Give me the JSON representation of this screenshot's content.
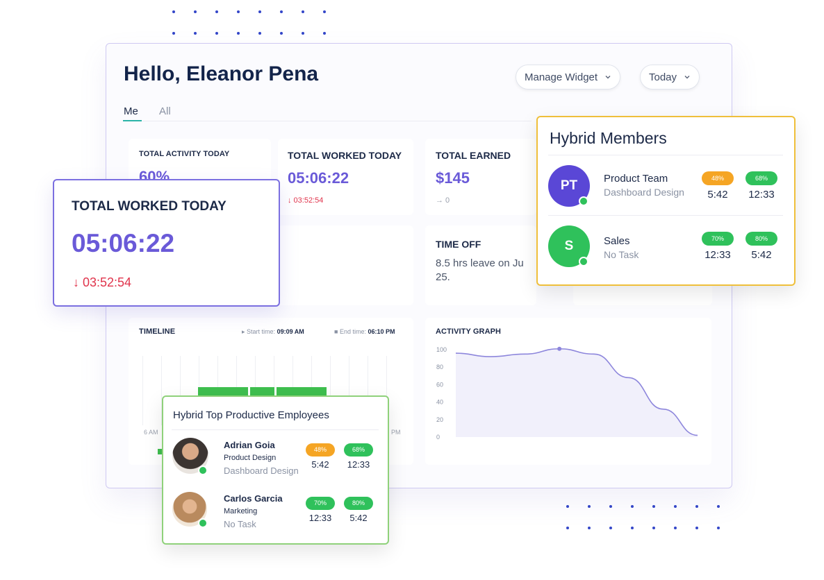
{
  "greeting": "Hello, Eleanor Pena",
  "header": {
    "manage_widget": "Manage Widget",
    "date_filter": "Today"
  },
  "tabs": [
    {
      "label": "Me",
      "active": true
    },
    {
      "label": "All",
      "active": false
    }
  ],
  "stats": {
    "activity": {
      "label": "TOTAL ACTIVITY TODAY",
      "value": "60%"
    },
    "worked": {
      "label": "TOTAL WORKED TODAY",
      "value": "05:06:22",
      "delta": "↓ 03:52:54"
    },
    "earned": {
      "label": "TOTAL EARNED",
      "value": "$145",
      "delta": "→ 0"
    },
    "time_off": {
      "label": "TIME OFF",
      "text": "8.5 hrs leave on Ju 25."
    }
  },
  "worked_popup": {
    "label": "TOTAL WORKED TODAY",
    "value": "05:06:22",
    "delta": "↓ 03:52:54"
  },
  "timeline": {
    "label": "TIMELINE",
    "start_label": "Start time:",
    "start_value": "09:09 AM",
    "end_label": "End time:",
    "end_value": "06:10 PM",
    "left_tick": "6 AM",
    "right_tick": "PM"
  },
  "chart_data": {
    "type": "line",
    "title": "ACTIVITY GRAPH",
    "xlabel": "",
    "ylabel": "",
    "ylim": [
      0,
      100
    ],
    "yticks": [
      "100",
      "80",
      "60",
      "40",
      "20",
      "0"
    ],
    "series": [
      {
        "x": [
          0,
          1,
          2,
          3,
          4,
          5,
          6,
          7
        ],
        "values": [
          96,
          92,
          95,
          101,
          95,
          68,
          32,
          2
        ]
      }
    ],
    "grid": false,
    "colors": {
      "line": "#8d86dc",
      "fill": "#f1f0fb"
    }
  },
  "hybrid_members": {
    "title": "Hybrid Members",
    "rows": [
      {
        "initials": "PT",
        "avatar_color": "#5a47d6",
        "name": "Product Team",
        "task": "Dashboard Design",
        "badge1": "48%",
        "badge1_color": "orange",
        "time1": "5:42",
        "badge2": "68%",
        "badge2_color": "green",
        "time2": "12:33"
      },
      {
        "initials": "S",
        "avatar_color": "#2fc15b",
        "name": "Sales",
        "task": "No Task",
        "badge1": "70%",
        "badge1_color": "green",
        "time1": "12:33",
        "badge2": "80%",
        "badge2_color": "green",
        "time2": "5:42"
      }
    ]
  },
  "top_employees": {
    "title": "Hybrid Top Productive Employees",
    "rows": [
      {
        "name": "Adrian Goia",
        "dept": "Product Design",
        "task": "Dashboard Design",
        "badge1": "48%",
        "badge1_color": "orange",
        "time1": "5:42",
        "badge2": "68%",
        "badge2_color": "green",
        "time2": "12:33"
      },
      {
        "name": "Carlos Garcia",
        "dept": "Marketing",
        "task": "No Task",
        "badge1": "70%",
        "badge1_color": "green",
        "time1": "12:33",
        "badge2": "80%",
        "badge2_color": "green",
        "time2": "5:42"
      }
    ]
  },
  "colors": {
    "accent_purple": "#6a5ad8",
    "down_red": "#e0344c",
    "badge_orange": "#f5a524",
    "badge_green": "#2fc15b",
    "hybrid_border": "#efbf3a",
    "employees_border": "#8fd17a"
  }
}
